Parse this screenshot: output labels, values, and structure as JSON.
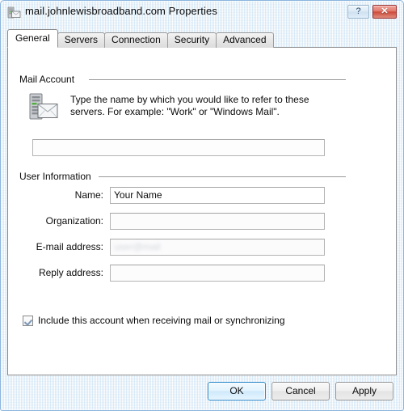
{
  "window": {
    "title": "mail.johnlewisbroadband.com Properties",
    "icon": "mail-server-icon",
    "help_button": "?",
    "close_button": "✕"
  },
  "tabs": [
    {
      "label": "General",
      "active": true
    },
    {
      "label": "Servers",
      "active": false
    },
    {
      "label": "Connection",
      "active": false
    },
    {
      "label": "Security",
      "active": false
    },
    {
      "label": "Advanced",
      "active": false
    }
  ],
  "mail_account": {
    "group_label": "Mail Account",
    "icon": "mail-server-icon",
    "description_line1": "Type the name by which you would like to refer to these",
    "description_line2": "servers.  For example: \"Work\" or \"Windows Mail\".",
    "account_name_value": "",
    "account_name_masked": true
  },
  "user_information": {
    "group_label": "User Information",
    "fields": [
      {
        "label": "Name:",
        "value": "Your Name",
        "masked": false
      },
      {
        "label": "Organization:",
        "value": "",
        "masked": false
      },
      {
        "label": "E-mail address:",
        "value": "user@mail",
        "masked": true
      },
      {
        "label": "Reply address:",
        "value": "",
        "masked": false
      }
    ]
  },
  "include_account": {
    "label": "Include this account when receiving mail or synchronizing",
    "checked": true
  },
  "footer": {
    "ok_label": "OK",
    "cancel_label": "Cancel",
    "apply_label": "Apply"
  },
  "colors": {
    "frame": "#dbe9f6",
    "frame_border": "#8ab4dd",
    "close_red": "#cd4a39",
    "default_button_border": "#2c89c9",
    "panel_bg": "#ffffff",
    "rule": "#9a9a9a"
  }
}
